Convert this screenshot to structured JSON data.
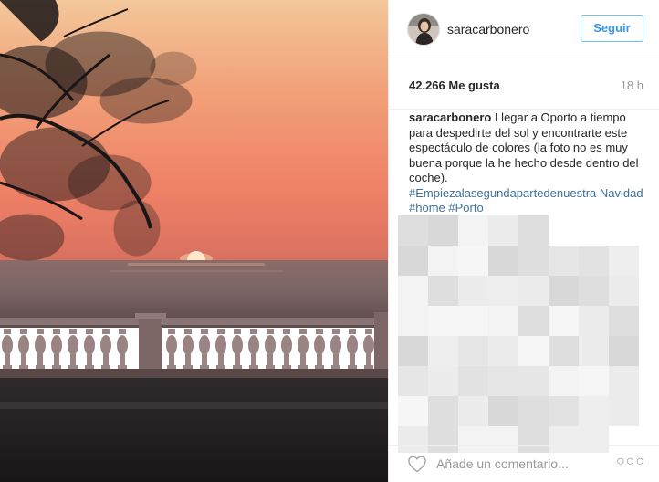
{
  "post": {
    "username": "saracarbonero",
    "follow_label": "Seguir",
    "likes": "42.266 Me gusta",
    "time_ago": "18 h",
    "caption": {
      "username": "saracarbonero",
      "text": "Llegar a Oporto a tiempo para despedirte del sol y encontrarte este espectáculo de colores (la foto no es muy buena porque la he hecho desde dentro del coche).",
      "hashtags": [
        "#Empiezalasegundapartedenuestra Navidad",
        "#home",
        "#Porto"
      ]
    },
    "comment_placeholder": "Añade un comentario...",
    "more_icon": "more-options-icon",
    "like_icon": "heart-icon"
  },
  "colors": {
    "follow_border": "#70c0e7",
    "follow_text": "#3897f0",
    "hashtag": "#3f729b",
    "muted": "#999999"
  }
}
